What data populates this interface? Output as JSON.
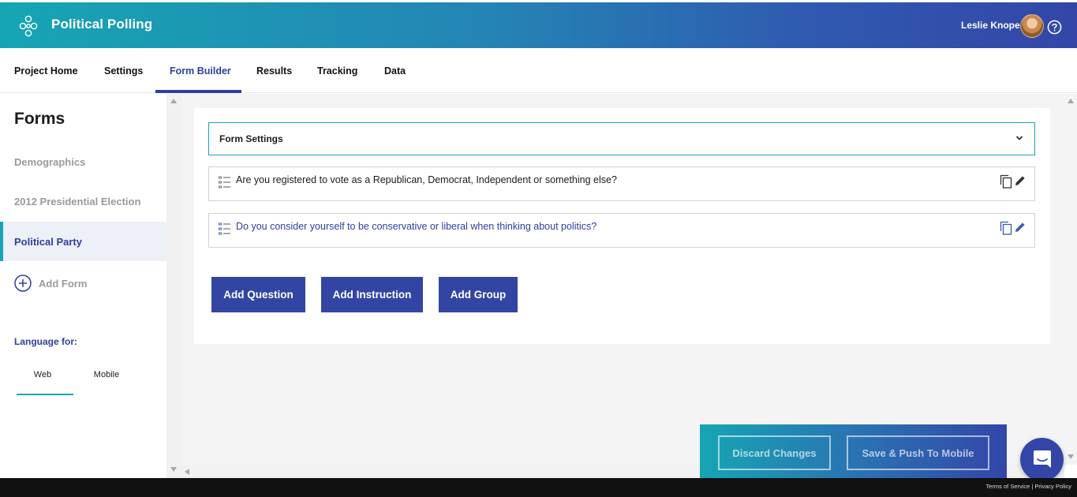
{
  "header": {
    "app_title": "Political Polling",
    "user_name": "Leslie Knope",
    "logo_icon": "flower-logo-icon",
    "help_icon": "help-circle-icon"
  },
  "nav": {
    "tabs": [
      {
        "label": "Project Home"
      },
      {
        "label": "Settings"
      },
      {
        "label": "Form Builder",
        "active": true
      },
      {
        "label": "Results"
      },
      {
        "label": "Tracking"
      },
      {
        "label": "Data"
      }
    ]
  },
  "sidebar": {
    "title": "Forms",
    "items": [
      {
        "label": "Demographics"
      },
      {
        "label": "2012 Presidential Election"
      },
      {
        "label": "Political Party",
        "active": true
      }
    ],
    "add_form_label": "Add Form",
    "language_label": "Language for:",
    "language_tabs": [
      {
        "label": "Web",
        "active": true
      },
      {
        "label": "Mobile"
      }
    ]
  },
  "form": {
    "settings_label": "Form Settings",
    "questions": [
      {
        "text": "Are you registered to vote as a Republican, Democrat, Independent or something else?"
      },
      {
        "text": "Do you consider yourself to be conservative or liberal when thinking about politics?"
      }
    ],
    "buttons": {
      "add_question": "Add Question",
      "add_instruction": "Add Instruction",
      "add_group": "Add Group"
    }
  },
  "savebar": {
    "discard_label": "Discard Changes",
    "save_label": "Save & Push To Mobile"
  },
  "footer": {
    "terms_label": "Terms of Service",
    "separator": "|",
    "privacy_label": "Privacy Policy"
  },
  "colors": {
    "accent": "#2e3f9e",
    "teal": "#19a5b4",
    "button": "#3345a3"
  }
}
